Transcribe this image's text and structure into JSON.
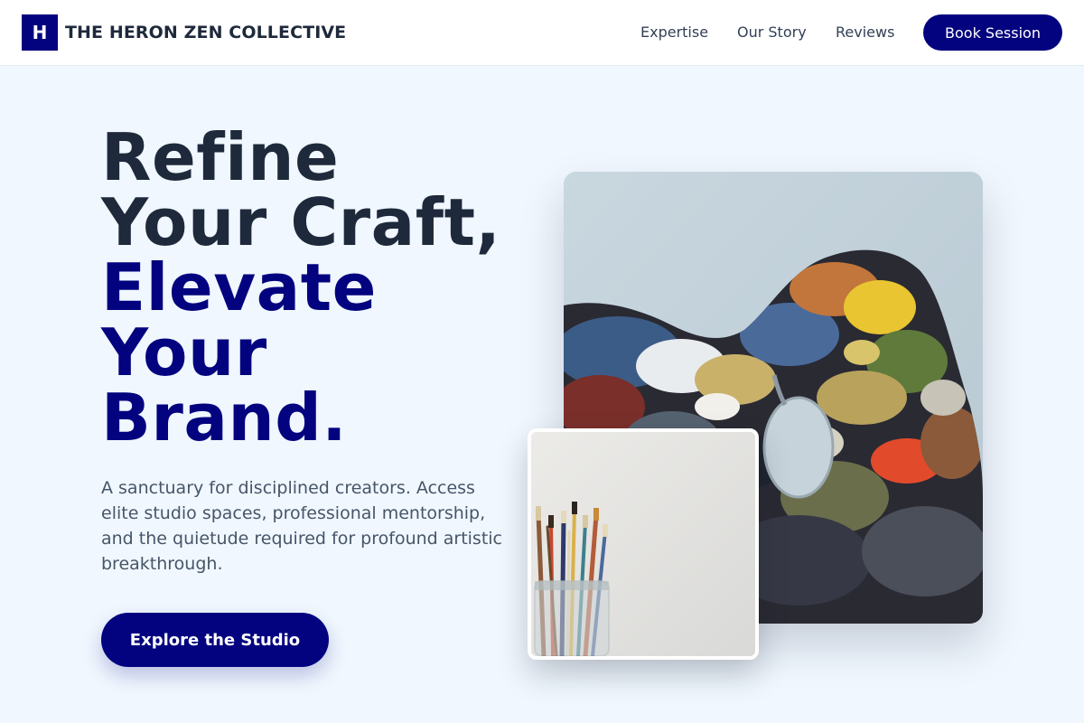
{
  "header": {
    "logo_letter": "H",
    "brand_name": "THE HERON ZEN COLLECTIVE",
    "nav": {
      "expertise": "Expertise",
      "story": "Our Story",
      "reviews": "Reviews"
    },
    "book_label": "Book Session"
  },
  "hero": {
    "headline": {
      "line1": "Refine",
      "line2": "Your Craft,",
      "line3": "Elevate",
      "line4": "Your",
      "line5": "Brand."
    },
    "subtext": "A sanctuary for disciplined creators. Access elite studio spaces, professional mentorship, and the quietude required for profound artistic breakthrough.",
    "cta_label": "Explore the Studio"
  },
  "colors": {
    "brand_navy": "#03037f",
    "headline_dark": "#1e293b",
    "page_bg": "#f0f7fe"
  }
}
